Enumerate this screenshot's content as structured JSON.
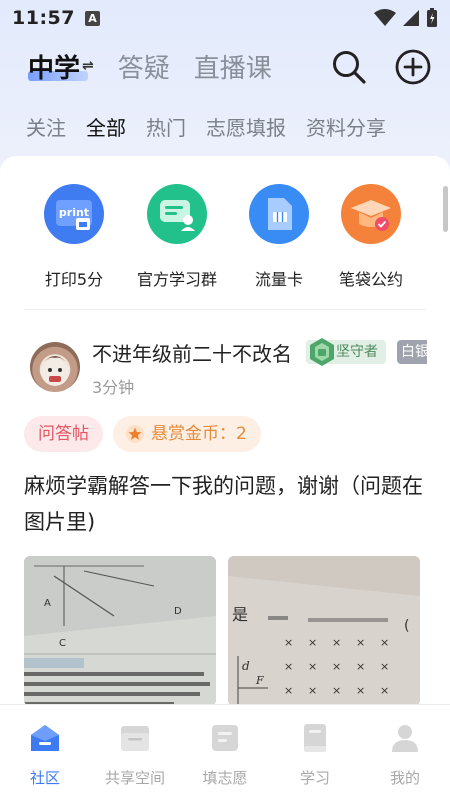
{
  "status_bar": {
    "time": "11:57",
    "notification_letter": "A"
  },
  "top_nav": {
    "tabs": [
      {
        "label": "中学",
        "active": true
      },
      {
        "label": "答疑",
        "active": false
      },
      {
        "label": "直播课",
        "active": false
      }
    ],
    "icons": [
      "search-icon",
      "add-icon"
    ]
  },
  "sub_nav": {
    "tabs": [
      "关注",
      "全部",
      "热门",
      "志愿填报",
      "资料分享"
    ],
    "active": "全部"
  },
  "quick_links": [
    {
      "label": "打印5分",
      "icon": "print-icon",
      "color": "#3f7cf2"
    },
    {
      "label": "官方学习群",
      "icon": "chat-group-icon",
      "color": "#22c08a"
    },
    {
      "label": "流量卡",
      "icon": "sim-card-icon",
      "color": "#3a8cf5"
    },
    {
      "label": "笔袋公约",
      "icon": "graduation-cap-icon",
      "color": "#f4823a"
    }
  ],
  "post": {
    "username": "不进年级前二十不改名",
    "badge_level": "坚守者",
    "badge_rank": "白银",
    "time": "3分钟",
    "tag_type": "问答帖",
    "tag_reward": "悬赏金币：2",
    "title": "麻烦学霸解答一下我的问题，谢谢（问题在图片里)"
  },
  "bottom_tabs": [
    {
      "label": "社区",
      "icon": "home-icon",
      "active": true
    },
    {
      "label": "共享空间",
      "icon": "folder-icon",
      "active": false
    },
    {
      "label": "填志愿",
      "icon": "document-icon",
      "active": false
    },
    {
      "label": "学习",
      "icon": "book-icon",
      "active": false
    },
    {
      "label": "我的",
      "icon": "user-icon",
      "active": false
    }
  ],
  "colors": {
    "accent": "#3d7bf5",
    "tag_qa": "#e25562",
    "tag_coin": "#e48a3a"
  }
}
